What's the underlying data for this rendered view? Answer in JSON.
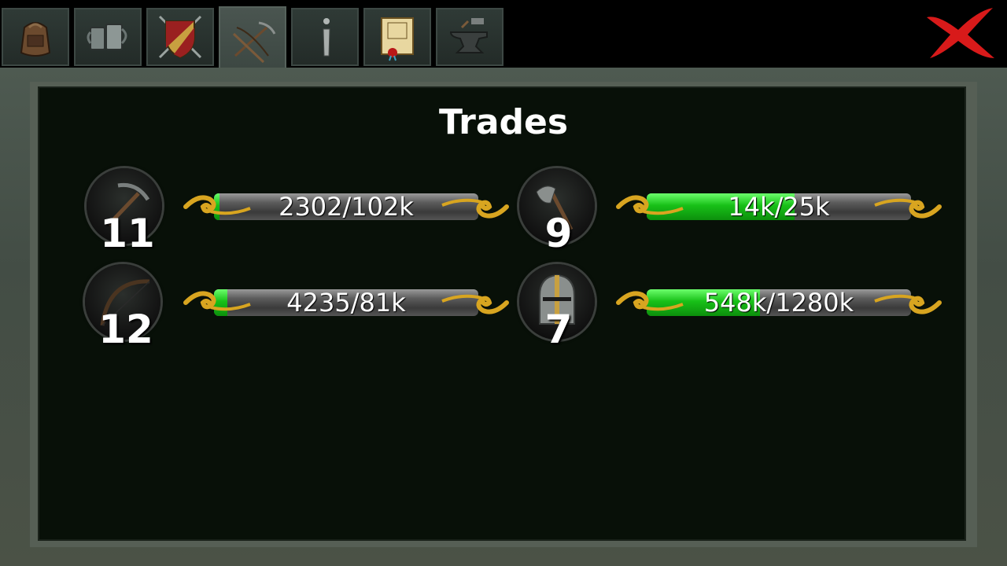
{
  "tabs": [
    {
      "icon": "backpack-icon"
    },
    {
      "icon": "tankards-icon"
    },
    {
      "icon": "shield-swords-icon"
    },
    {
      "icon": "tools-icon",
      "active": true
    },
    {
      "icon": "dagger-icon"
    },
    {
      "icon": "scroll-icon"
    },
    {
      "icon": "anvil-icon"
    }
  ],
  "close_icon": "red-x-close-icon",
  "title": "Trades",
  "trades": [
    {
      "icon": "pickaxe-icon",
      "level": "11",
      "progress_text": "2302/102k",
      "progress": 0.02
    },
    {
      "icon": "axe-icon",
      "level": "9",
      "progress_text": "14k/25k",
      "progress": 0.56
    },
    {
      "icon": "bow-icon",
      "level": "12",
      "progress_text": "4235/81k",
      "progress": 0.05
    },
    {
      "icon": "helmet-icon",
      "level": "7",
      "progress_text": "548k/1280k",
      "progress": 0.43
    }
  ],
  "colors": {
    "panel": "#081008",
    "progress_green": "#18c018",
    "close_red": "#d81a1a",
    "scroll_gold": "#d8a520"
  }
}
